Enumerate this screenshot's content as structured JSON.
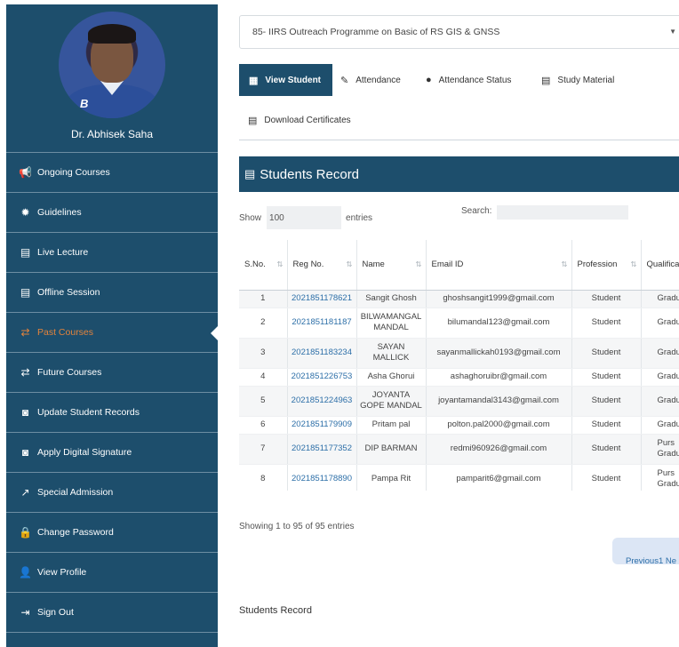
{
  "profile": {
    "name": "Dr. Abhisek Saha"
  },
  "sidebar": {
    "items": [
      {
        "label": "Ongoing Courses",
        "icon": "megaphone-icon",
        "glyph": "📢"
      },
      {
        "label": "Guidelines",
        "icon": "gear-icon",
        "glyph": "✹"
      },
      {
        "label": "Live Lecture",
        "icon": "book-icon",
        "glyph": "▤"
      },
      {
        "label": "Offline Session",
        "icon": "book-icon",
        "glyph": "▤"
      },
      {
        "label": "Past Courses",
        "icon": "exchange-icon",
        "glyph": "⇄"
      },
      {
        "label": "Future Courses",
        "icon": "exchange-icon",
        "glyph": "⇄"
      },
      {
        "label": "Update Student Records",
        "icon": "user-card-icon",
        "glyph": "◙"
      },
      {
        "label": "Apply Digital Signature",
        "icon": "user-card-icon",
        "glyph": "◙"
      },
      {
        "label": "Special Admission",
        "icon": "external-link-icon",
        "glyph": "↗"
      },
      {
        "label": "Change Password",
        "icon": "lock-icon",
        "glyph": "🔒"
      },
      {
        "label": "View Profile",
        "icon": "user-icon",
        "glyph": "👤"
      },
      {
        "label": "Sign Out",
        "icon": "sign-out-icon",
        "glyph": "⇥"
      }
    ],
    "active_index": 4
  },
  "course_select": {
    "value": "85- IIRS Outreach Programme on Basic of RS GIS & GNSS"
  },
  "tabs": [
    {
      "label": "View Student",
      "icon": "grid-icon",
      "glyph": "▦"
    },
    {
      "label": "Attendance",
      "icon": "pencil-icon",
      "glyph": "✎"
    },
    {
      "label": "Attendance Status",
      "icon": "info-icon",
      "glyph": "●"
    },
    {
      "label": "Study Material",
      "icon": "book-icon",
      "glyph": "▤"
    },
    {
      "label": "Download Certificates",
      "icon": "book-icon",
      "glyph": "▤"
    }
  ],
  "records": {
    "title": "Students Record",
    "show_label": "Show",
    "show_value": "100",
    "entries_label": "entries",
    "search_label": "Search:",
    "columns": [
      "S.No.",
      "Reg No.",
      "Name",
      "Email ID",
      "Profession",
      "Qualifica"
    ],
    "rows": [
      {
        "sno": "1",
        "reg": "2021851178621",
        "name": "Sangit Ghosh",
        "email": "ghoshsangit1999@gmail.com",
        "profession": "Student",
        "qual": "Gradu"
      },
      {
        "sno": "2",
        "reg": "2021851181187",
        "name": "BILWAMANGAL MANDAL",
        "email": "bilumandal123@gmail.com",
        "profession": "Student",
        "qual": "Gradu"
      },
      {
        "sno": "3",
        "reg": "2021851183234",
        "name": "SAYAN MALLICK",
        "email": "sayanmallickah0193@gmail.com",
        "profession": "Student",
        "qual": "Gradu"
      },
      {
        "sno": "4",
        "reg": "2021851226753",
        "name": "Asha Ghorui",
        "email": "ashaghoruibr@gmail.com",
        "profession": "Student",
        "qual": "Gradu"
      },
      {
        "sno": "5",
        "reg": "2021851224963",
        "name": "JOYANTA GOPE MANDAL",
        "email": "joyantamandal3143@gmail.com",
        "profession": "Student",
        "qual": "Gradu"
      },
      {
        "sno": "6",
        "reg": "2021851179909",
        "name": "Pritam pal",
        "email": "polton.pal2000@gmail.com",
        "profession": "Student",
        "qual": "Gradu"
      },
      {
        "sno": "7",
        "reg": "2021851177352",
        "name": "DIP BARMAN",
        "email": "redmi960926@gmail.com",
        "profession": "Student",
        "qual": "Purs Gradu"
      },
      {
        "sno": "8",
        "reg": "2021851178890",
        "name": "Pampa Rit",
        "email": "pamparit6@gmail.com",
        "profession": "Student",
        "qual": "Purs Gradu"
      }
    ],
    "info": "Showing 1 to 95 of 95 entries",
    "pager": "Previous1 Ne"
  },
  "footer": {
    "text": "Students Record"
  }
}
